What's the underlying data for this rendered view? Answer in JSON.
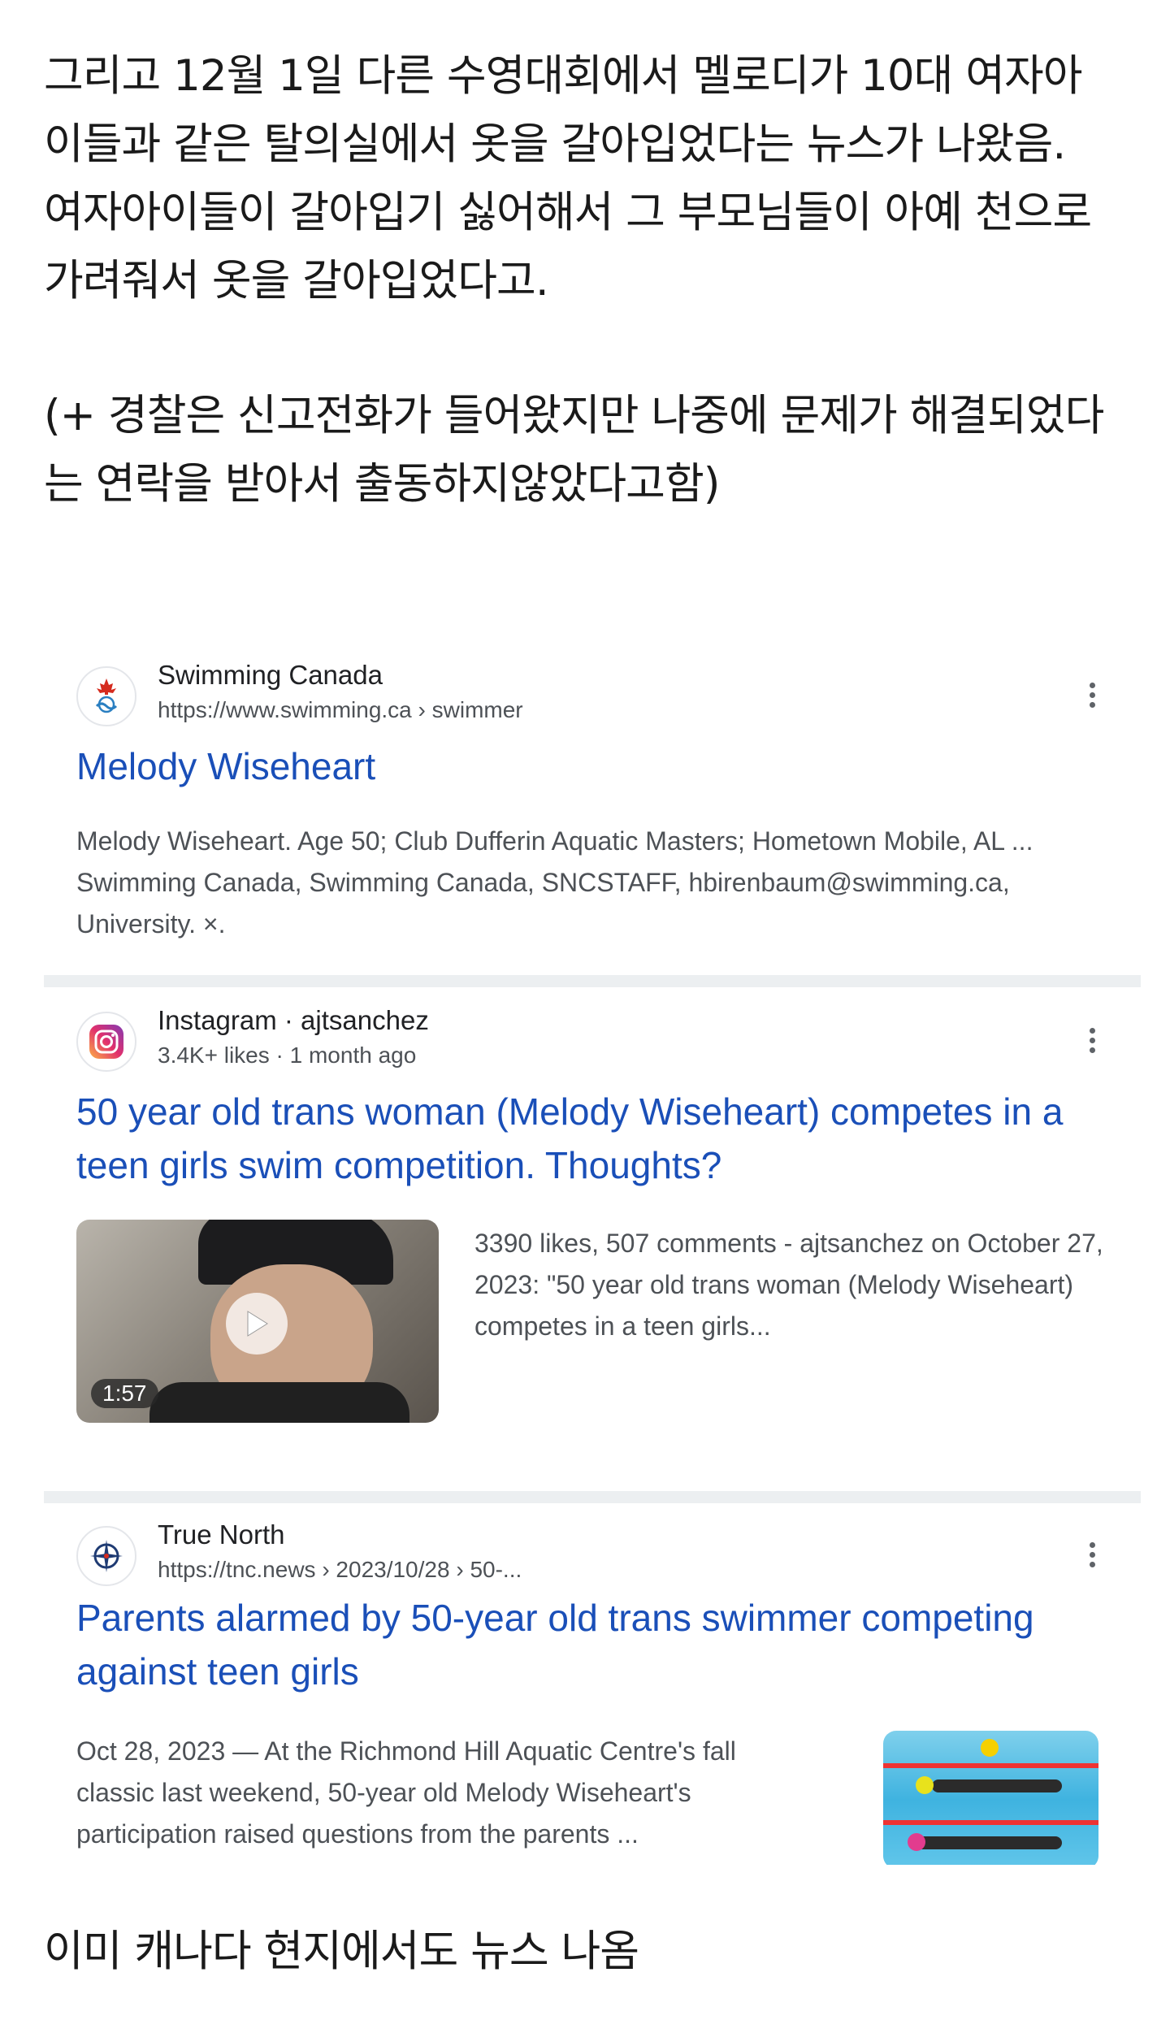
{
  "post": {
    "intro": "그리고 12월 1일 다른 수영대회에서 멜로디가 10대 여자아\n이들과 같은 탈의실에서 옷을 갈아입었다는 뉴스가 나왔음.\n여자아이들이 갈아입기 싫어해서 그 부모님들이 아예 천으로\n가려줘서 옷을 갈아입었다고.",
    "police_note": "(+ 경찰은 신고전화가 들어왔지만 나중에 문제가 해결되었다\n는 연락을 받아서 출동하지않았다고함)",
    "closing": "이미 캐나다 현지에서도 뉴스 나옴"
  },
  "results": [
    {
      "site_name": "Swimming Canada",
      "url": "https://www.swimming.ca › swimmer",
      "title": "Melody Wiseheart",
      "snippet": "Melody Wiseheart. Age 50; Club Dufferin Aquatic Masters; Hometown Mobile, AL ... Swimming Canada, Swimming Canada, SNCSTAFF, hbirenbaum@swimming.ca, University. ×.",
      "favicon": "swimming-canada-maple-leaf-icon"
    },
    {
      "site_name": "Instagram · ajtsanchez",
      "meta": "3.4K+ likes · 1 month ago",
      "title": "50 year old trans woman (Melody Wiseheart) competes in a teen girls swim competition. Thoughts?",
      "snippet": "3390 likes, 507 comments - ajtsanchez on October 27, 2023: \"50 year old trans woman (Melody Wiseheart) competes in a teen girls...",
      "video_duration": "1:57",
      "favicon": "instagram-icon"
    },
    {
      "site_name": "True North",
      "url": "https://tnc.news › 2023/10/28 › 50-...",
      "title": "Parents alarmed by 50-year old trans swimmer competing against teen girls",
      "snippet": "Oct 28, 2023 — At the Richmond Hill Aquatic Centre's fall classic last weekend, 50-year old Melody Wiseheart's participation raised questions from the parents ...",
      "favicon": "true-north-compass-icon"
    }
  ],
  "colors": {
    "link": "#1a4fb8",
    "snippet": "#4d5156",
    "separator": "#eceff1"
  }
}
